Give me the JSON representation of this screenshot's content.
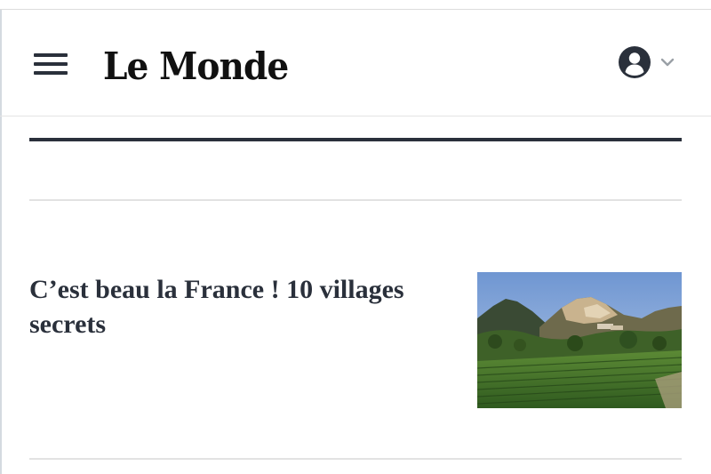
{
  "header": {
    "logo_text": "Le Monde",
    "menu_icon": "hamburger-menu-icon",
    "account_icon": "user-circle-icon",
    "account_chevron_icon": "chevron-down-icon"
  },
  "article": {
    "title": "C’est beau la France ! 10 villages secrets",
    "thumbnail": "landscape-photo-vineyard-hills"
  },
  "colors": {
    "text_dark": "#2a303b",
    "rule_light": "#e2e2e2",
    "chevron": "#9aa0a6"
  }
}
